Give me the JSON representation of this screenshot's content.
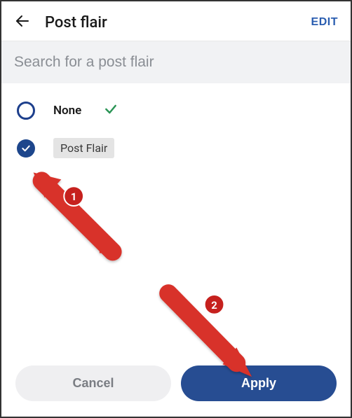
{
  "header": {
    "title": "Post flair",
    "edit_label": "EDIT"
  },
  "search": {
    "placeholder": "Search for a post flair",
    "value": ""
  },
  "flair": {
    "none_label": "None",
    "selected_chip": "Post Flair"
  },
  "footer": {
    "cancel_label": "Cancel",
    "apply_label": "Apply"
  },
  "annotations": {
    "badge1": "1",
    "badge2": "2"
  },
  "colors": {
    "primary": "#274d92",
    "edit_link": "#2a5db0",
    "arrow": "#d8302a",
    "badge": "#c6211e"
  }
}
